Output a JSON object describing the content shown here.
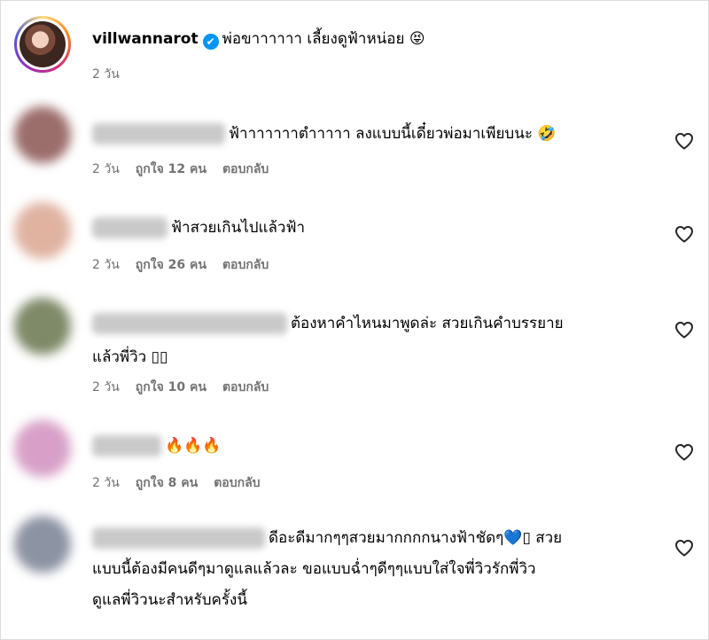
{
  "post": {
    "username": "villwannarot",
    "verified_mark": "✔",
    "caption": "พ่อขาาาาาา เลี้ยงดูฟ้าหน่อย 😝",
    "time": "2 วัน"
  },
  "comments": [
    {
      "text": "ฟ้าาาาาาาตำาาาา ลงแบบนี้เดี๋ยวพ่อมาเพียบนะ 🤣",
      "time": "2 วัน",
      "likes": "ถูกใจ 12 คน",
      "reply": "ตอบกลับ",
      "avatar_color": "#9b6d6b"
    },
    {
      "text": "ฟ้าสวยเกินไปแล้วฟ้า",
      "time": "2 วัน",
      "likes": "ถูกใจ 26 คน",
      "reply": "ตอบกลับ",
      "avatar_color": "#e0b3a1"
    },
    {
      "text_line1": "ต้องหาคำไหนมาพูดล่ะ สวยเกินคำบรรยาย",
      "text_line2": "แล้วพี่วิว ▯▯",
      "time": "2 วัน",
      "likes": "ถูกใจ 10 คน",
      "reply": "ตอบกลับ",
      "avatar_color": "#7f8a68"
    },
    {
      "text": "🔥🔥🔥",
      "time": "2 วัน",
      "likes": "ถูกใจ 8 คน",
      "reply": "ตอบกลับ",
      "avatar_color": "#d8a0c8"
    },
    {
      "text_line1": "ดีอะดีมากๆๆสวยมากกกกนางฟ้าชัดๆ💙▯ สวย",
      "text_line2": "แบบนี้ต้องมีคนดีๆมาดูแลแล้วละ ขอแบบฉ่ำๆดีๆๆแบบใส่ใจพี่วิวรักพี่วิว",
      "text_line3": "ดูแลพี่วิวนะสำหรับครั้งนี้",
      "avatar_color": "#8c93a3"
    }
  ],
  "icons": {
    "heart": "heart-outline-icon"
  }
}
